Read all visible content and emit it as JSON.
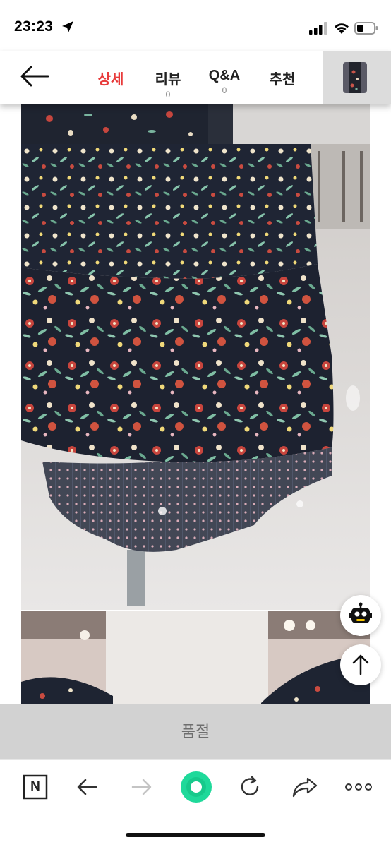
{
  "status_bar": {
    "time": "23:23",
    "icons": [
      "location-arrow-icon",
      "cellular-signal-icon",
      "wifi-icon",
      "battery-icon"
    ]
  },
  "product_nav": {
    "back_icon": "arrow-left-icon",
    "tabs": [
      {
        "label": "상세",
        "count": ""
      },
      {
        "label": "리뷰",
        "count": "0"
      },
      {
        "label": "Q&A",
        "count": "0"
      },
      {
        "label": "추천",
        "count": ""
      }
    ],
    "active_tab": "상세",
    "active_color": "#e83b3b"
  },
  "content": {
    "images": [
      "floral-dress-hem-photo",
      "floral-dress-skirt-photo",
      "floral-dress-neckline-photo"
    ],
    "floating_buttons": [
      "chatbot-icon",
      "arrow-up-icon"
    ]
  },
  "soldout_bar": {
    "label": "품절"
  },
  "browser_toolbar": {
    "brand_label": "N",
    "icons": [
      "naver-n-icon",
      "back-arrow-icon",
      "forward-arrow-icon",
      "green-circle-icon",
      "reload-icon",
      "share-icon",
      "more-dots-icon"
    ],
    "accent_color": "#1fd99a"
  }
}
